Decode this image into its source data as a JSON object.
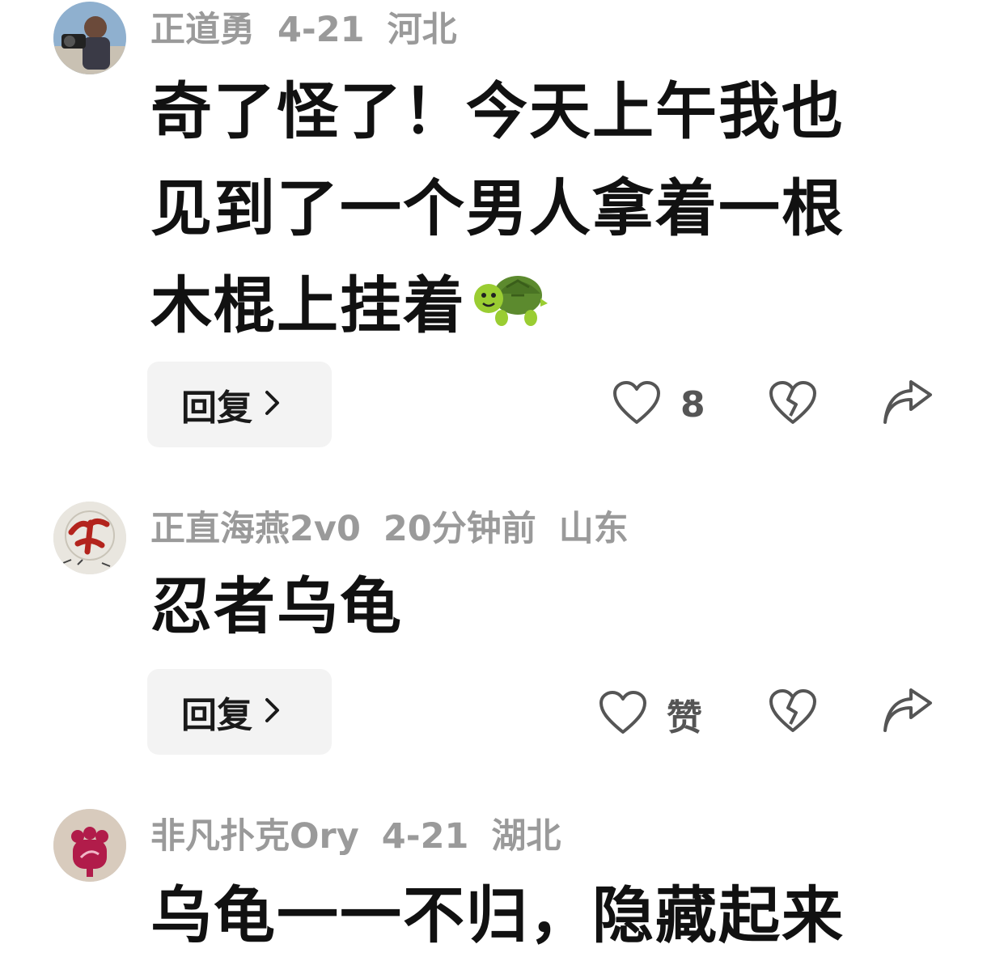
{
  "comments": [
    {
      "user": "正道勇",
      "time": "4-21",
      "region": "河北",
      "text": "奇了怪了！今天上午我也见到了一个男人拿着一根木棍上挂着",
      "emoji": "turtle",
      "reply_label": "回复",
      "like_label": "8"
    },
    {
      "user": "正直海燕2v0",
      "time": "20分钟前",
      "region": "山东",
      "text": "忍者乌龟",
      "reply_label": "回复",
      "like_label": "赞"
    },
    {
      "user": "非凡扑克Ory",
      "time": "4-21",
      "region": "湖北",
      "text": "乌龟一一不归，隐藏起来"
    }
  ],
  "icons": {
    "like": "heart-outline-icon",
    "dislike": "broken-heart-icon",
    "share": "share-arrow-icon",
    "chevron": "chevron-right-icon"
  },
  "colors": {
    "meta_text": "#9a9a9a",
    "body_text": "#111111",
    "reply_bg": "#f3f3f3",
    "icon_gray": "#555555"
  }
}
